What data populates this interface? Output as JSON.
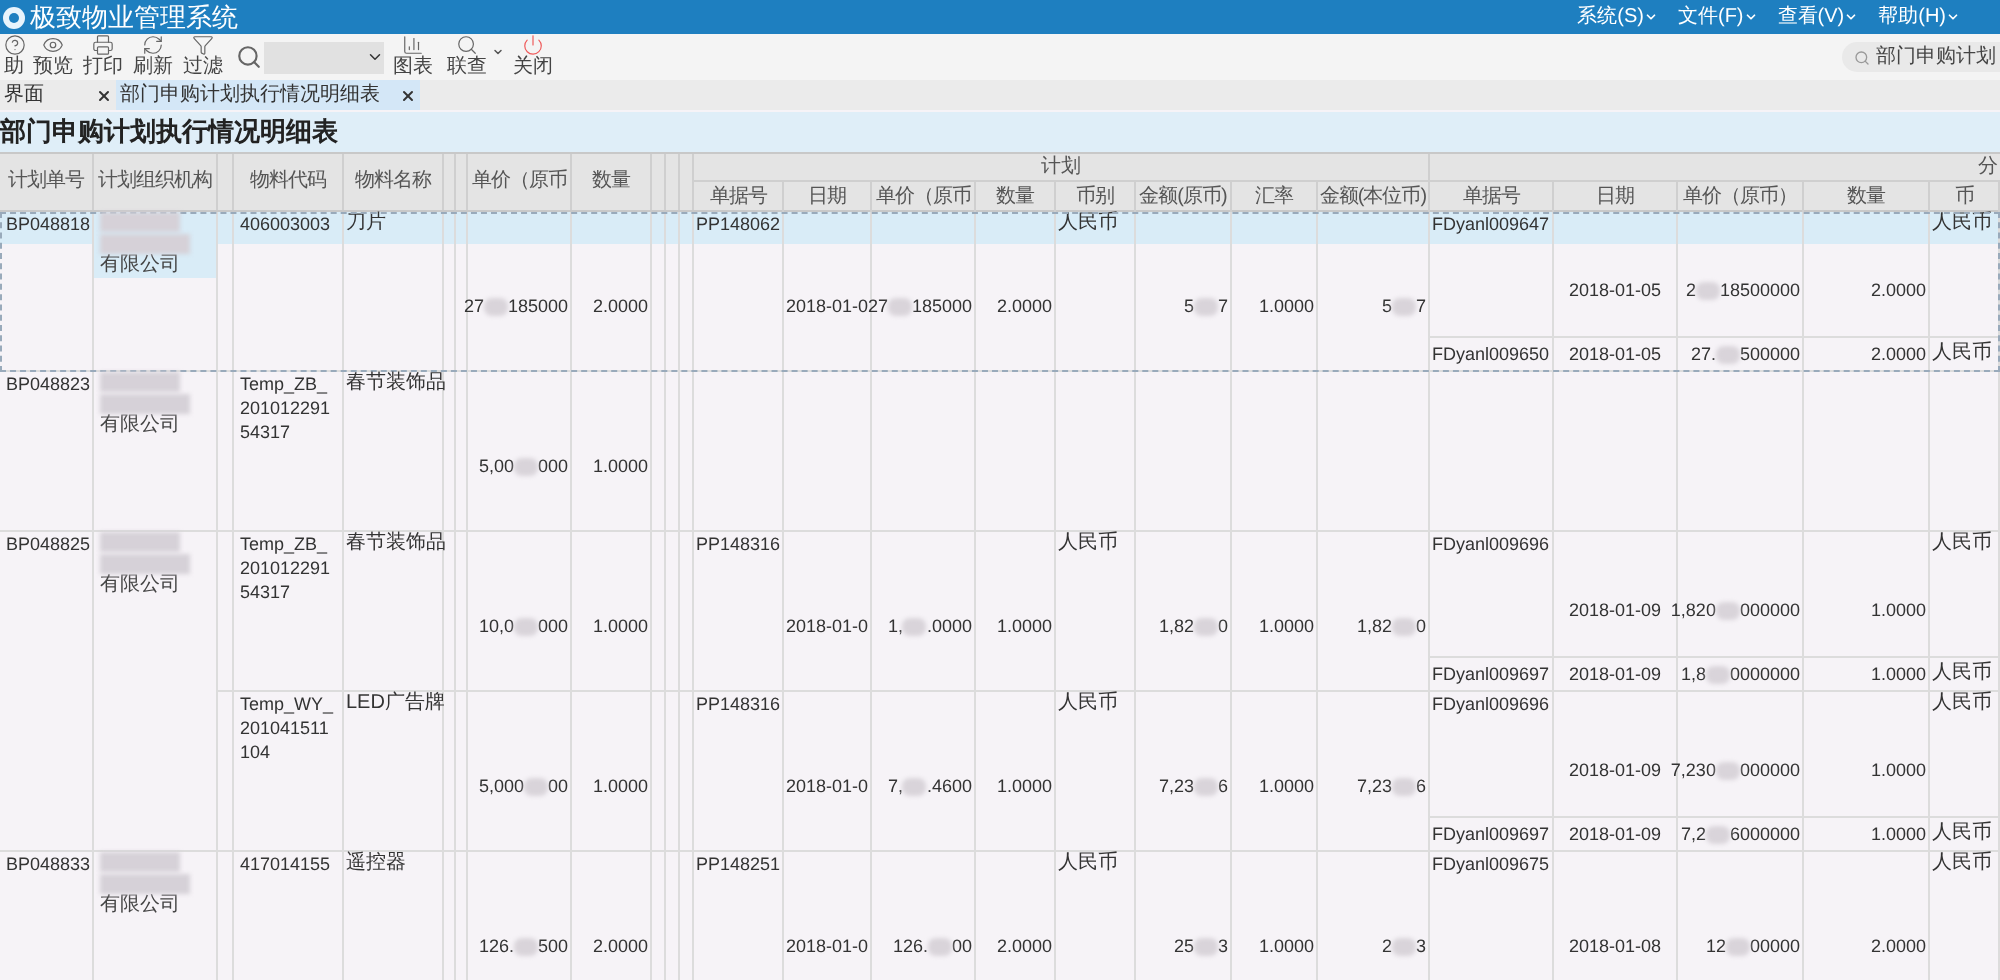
{
  "app": {
    "title": "极致物业管理系统",
    "menus": [
      "系统(S)",
      "文件(F)",
      "查看(V)",
      "帮助(H)"
    ]
  },
  "toolbar": {
    "left": [
      {
        "label": "助"
      },
      {
        "label": "预览"
      },
      {
        "label": "打印"
      },
      {
        "label": "刷新"
      },
      {
        "label": "过滤"
      }
    ],
    "right": [
      {
        "label": "图表"
      },
      {
        "label": "联查",
        "has_menu": true
      },
      {
        "label": "关闭"
      }
    ],
    "global_search": "部门申购计划"
  },
  "tabs": [
    {
      "label": "界面",
      "selected": false
    },
    {
      "label": "部门申购计划执行情况明细表",
      "selected": true
    }
  ],
  "report_title": "部门申购计划执行情况明细表",
  "columns": {
    "left": [
      "计划单号",
      "计划组织机构",
      "物料代码",
      "物料名称",
      "单价（原币",
      "数量"
    ],
    "plan_group": "计划",
    "plan": [
      "单据号",
      "日期",
      "单价（原币",
      "数量",
      "币别",
      "金额(原币)",
      "汇率",
      "金额(本位币)"
    ],
    "fen_group": "分",
    "fen": [
      "单据号",
      "日期",
      "单价（原币）",
      "数量",
      "币"
    ]
  },
  "plans": [
    {
      "no": "BP048818",
      "org": "有限公司",
      "selected": true,
      "items": [
        {
          "code": "406003003",
          "name": "刀片",
          "price": [
            "27",
            "185000"
          ],
          "qty": "2.0000",
          "plan": {
            "doc": "PP148062",
            "date": "2018-01-0",
            "price": [
              "27",
              "185000"
            ],
            "qty": "2.0000",
            "currency": "人民币",
            "amount": [
              "5",
              "7"
            ],
            "rate": "1.0000",
            "amount_base": [
              "5",
              "7"
            ]
          },
          "fen": [
            {
              "doc": "FDyanl009647",
              "date": "2018-01-05",
              "price": [
                "2",
                "18500000"
              ],
              "qty": "2.0000",
              "currency": "人民币"
            },
            {
              "doc": "FDyanl009650",
              "date": "2018-01-05",
              "price": [
                "27.",
                "500000"
              ],
              "qty": "2.0000",
              "currency": "人民币"
            }
          ]
        }
      ]
    },
    {
      "no": "BP048823",
      "org": "有限公司",
      "selected": false,
      "items": [
        {
          "code": "Temp_ZB_20101229154317",
          "name": "春节装饰品",
          "price": [
            "5,00",
            "000"
          ],
          "qty": "1.0000"
        }
      ]
    },
    {
      "no": "BP048825",
      "org": "有限公司",
      "selected": false,
      "items": [
        {
          "code": "Temp_ZB_20101229154317",
          "name": "春节装饰品",
          "price": [
            "10,0",
            "000"
          ],
          "qty": "1.0000",
          "plan": {
            "doc": "PP148316",
            "date": "2018-01-0",
            "price": [
              "1,",
              ".0000"
            ],
            "qty": "1.0000",
            "currency": "人民币",
            "amount": [
              "1,82",
              "0"
            ],
            "rate": "1.0000",
            "amount_base": [
              "1,82",
              "0"
            ]
          },
          "fen": [
            {
              "doc": "FDyanl009696",
              "date": "2018-01-09",
              "price": [
                "1,820",
                "000000"
              ],
              "qty": "1.0000",
              "currency": "人民币"
            },
            {
              "doc": "FDyanl009697",
              "date": "2018-01-09",
              "price": [
                "1,8",
                "0000000"
              ],
              "qty": "1.0000",
              "currency": "人民币"
            }
          ]
        },
        {
          "code": "Temp_WY_201041511104",
          "name": "LED广告牌",
          "price": [
            "5,000",
            "00"
          ],
          "qty": "1.0000",
          "plan": {
            "doc": "PP148316",
            "date": "2018-01-0",
            "price": [
              "7,",
              ".4600"
            ],
            "qty": "1.0000",
            "currency": "人民币",
            "amount": [
              "7,23",
              "6"
            ],
            "rate": "1.0000",
            "amount_base": [
              "7,23",
              "6"
            ]
          },
          "fen": [
            {
              "doc": "FDyanl009696",
              "date": "2018-01-09",
              "price": [
                "7,230",
                "000000"
              ],
              "qty": "1.0000",
              "currency": "人民币"
            },
            {
              "doc": "FDyanl009697",
              "date": "2018-01-09",
              "price": [
                "7,2",
                "6000000"
              ],
              "qty": "1.0000",
              "currency": "人民币"
            }
          ]
        }
      ]
    },
    {
      "no": "BP048833",
      "org": "有限公司",
      "selected": false,
      "items": [
        {
          "code": "417014155",
          "name": "遥控器",
          "price": [
            "126.",
            "500"
          ],
          "qty": "2.0000",
          "plan": {
            "doc": "PP148251",
            "date": "2018-01-0",
            "price": [
              "126.",
              "00"
            ],
            "qty": "2.0000",
            "currency": "人民币",
            "amount": [
              "25",
              "3"
            ],
            "rate": "1.0000",
            "amount_base": [
              "2",
              "3"
            ]
          },
          "fen": [
            {
              "doc": "FDyanl009675",
              "date": "2018-01-08",
              "price": [
                "12",
                "00000"
              ],
              "qty": "2.0000",
              "currency": "人民币"
            }
          ]
        }
      ]
    }
  ]
}
